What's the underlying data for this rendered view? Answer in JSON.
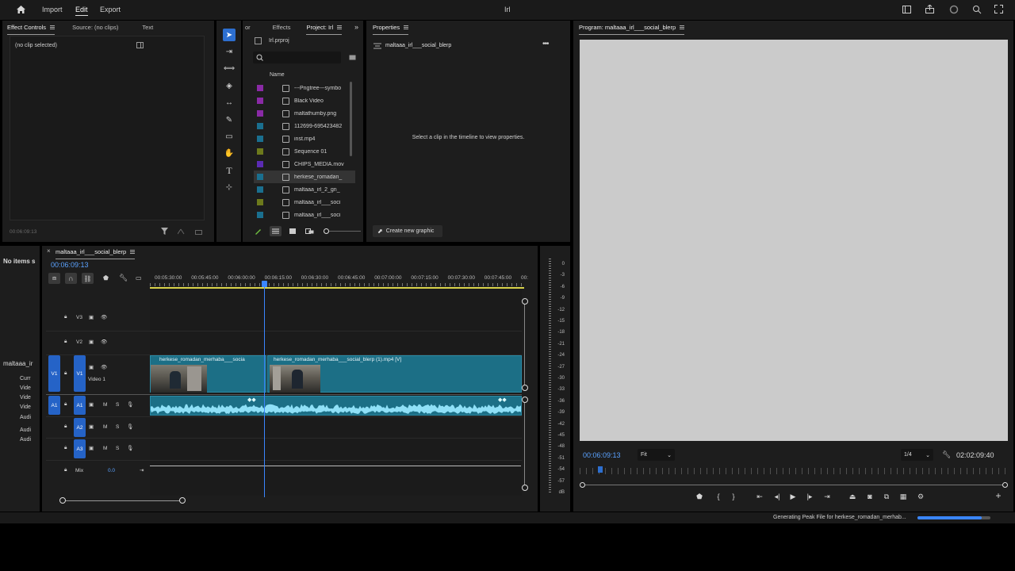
{
  "topbar": {
    "home_icon": "home-icon",
    "menu": [
      "Import",
      "Edit",
      "Export"
    ],
    "active_menu": "Edit",
    "title": "Irl",
    "right_icons": [
      "workspace-icon",
      "share-icon",
      "progress-icon",
      "quick-search-icon",
      "fullscreen-icon"
    ]
  },
  "effect_panel": {
    "tabs": [
      "Effect Controls",
      "Source: (no clips)",
      "Text"
    ],
    "no_clip": "(no clip selected)",
    "timecode": "00:06:09:13"
  },
  "project_panel": {
    "tabs": [
      "or",
      "Effects",
      "Project: Irl"
    ],
    "project_file": "Irl.prproj",
    "search_placeholder": "",
    "column_name": "Name",
    "items": [
      {
        "name": "---Pngtree---symbo",
        "color": "#8a2aa6"
      },
      {
        "name": "Black Video",
        "color": "#8a2aa6"
      },
      {
        "name": "maltathumby.png",
        "color": "#8a2aa6"
      },
      {
        "name": "112699-695423482",
        "color": "#1a6f8f"
      },
      {
        "name": "inst.mp4",
        "color": "#1a6f8f"
      },
      {
        "name": "Sequence 01",
        "color": "#6d7a1c"
      },
      {
        "name": "CHIPS_MEDIA.mov",
        "color": "#5b2bb3"
      },
      {
        "name": "herkese_romadan_",
        "color": "#1a6f8f"
      },
      {
        "name": "maltaaa_irl_2_gn_",
        "color": "#1a6f8f"
      },
      {
        "name": "maltaaa_irl___soci",
        "color": "#6d7a1c"
      },
      {
        "name": "maltaaa_irl___soci",
        "color": "#1a6f8f"
      }
    ]
  },
  "properties_panel": {
    "title": "Properties",
    "sequence": "maltaaa_irl___social_blerp",
    "message": "Select a clip in the timeline to view properties.",
    "create_button": "Create new graphic"
  },
  "program_monitor": {
    "title": "Program: maltaaa_irl___social_blerp",
    "timecode": "00:06:09:13",
    "zoom": "Fit",
    "resolution": "1/4",
    "duration": "02:02:09:40"
  },
  "left_strip": {
    "no_items": "No items s",
    "seq_name": "maltaaa_ir",
    "rows": [
      "Curr",
      "Vide",
      "Vide",
      "Vide",
      "Audi",
      "Audi",
      "Audi"
    ]
  },
  "timeline": {
    "sequence_tab": "maltaaa_irl___social_blerp",
    "timecode": "00:06:09:13",
    "ruler": [
      "00:05:30:00",
      "00:05:45:00",
      "00:06:00:00",
      "00:06:15:00",
      "00:06:30:00",
      "00:06:45:00",
      "00:07:00:00",
      "00:07:15:00",
      "00:07:30:00",
      "00:07:45:00",
      "00:"
    ],
    "video_tracks": [
      "V3",
      "V2",
      "V1"
    ],
    "video1_label": "Video 1",
    "audio_tracks": [
      "A1",
      "A2",
      "A3"
    ],
    "mix_label": "Mix",
    "mix_value": "0.0",
    "clip1": "herkese_romadan_merhaba___socia",
    "clip2": "herkese_romadan_merhaba___social_blerp (1).mp4 [V]",
    "m": "M",
    "s": "S"
  },
  "meter": {
    "ticks": [
      "0",
      "-3",
      "-6",
      "-9",
      "-12",
      "-15",
      "-18",
      "-21",
      "-24",
      "-27",
      "-30",
      "-33",
      "-36",
      "-39",
      "-42",
      "-45",
      "-48",
      "-51",
      "-54",
      "-57",
      "dB"
    ]
  },
  "status": {
    "text": "Generating Peak File for herkese_romadan_merhab...",
    "progress": 0.88
  }
}
